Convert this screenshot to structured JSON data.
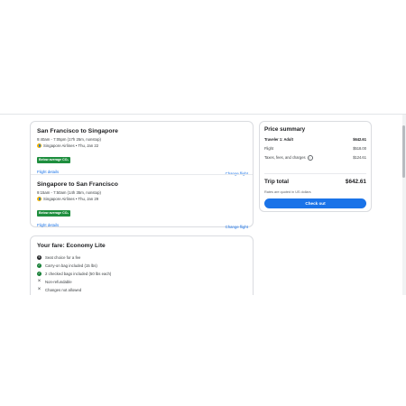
{
  "flights": [
    {
      "route": "San Francisco to Singapore",
      "times": "9:40am - 7:05pm (17h 25m, nonstop)",
      "airline": "Singapore Airlines • Thu, Jan 22",
      "badge": "Below average CO₂",
      "details_link": "Flight details",
      "change_link": "Change flight"
    },
    {
      "route": "Singapore to San Francisco",
      "times": "9:15am - 7:50am (14h 35m, nonstop)",
      "airline": "Singapore Airlines • Thu, Jan 29",
      "badge": "Below average CO₂",
      "details_link": "Flight details",
      "change_link": "Change flight"
    }
  ],
  "fare": {
    "title": "Your fare: Economy Lite",
    "items": [
      {
        "text": "Seat choice for a fee",
        "icon": "dollar-icon"
      },
      {
        "text": "Carry-on bag included (15 lbs)",
        "icon": "check-icon"
      },
      {
        "text": "2 checked bags included (50 lbs each)",
        "icon": "check-icon"
      },
      {
        "text": "Non-refundable",
        "icon": "x-icon"
      },
      {
        "text": "Changes not allowed",
        "icon": "x-icon"
      }
    ]
  },
  "summary": {
    "title": "Price summary",
    "traveler_label": "Traveler 1: Adult",
    "traveler_value": "$642.61",
    "flight_label": "Flight",
    "flight_value": "$518.00",
    "taxes_label": "Taxes, fees, and charges",
    "taxes_value": "$124.61",
    "total_label": "Trip total",
    "total_value": "$642.61",
    "rates_note": "Rates are quoted in US dollars",
    "checkout_label": "Check out"
  },
  "colors": {
    "accent": "#1a73e8",
    "eco_badge": "#1e8e3e"
  }
}
